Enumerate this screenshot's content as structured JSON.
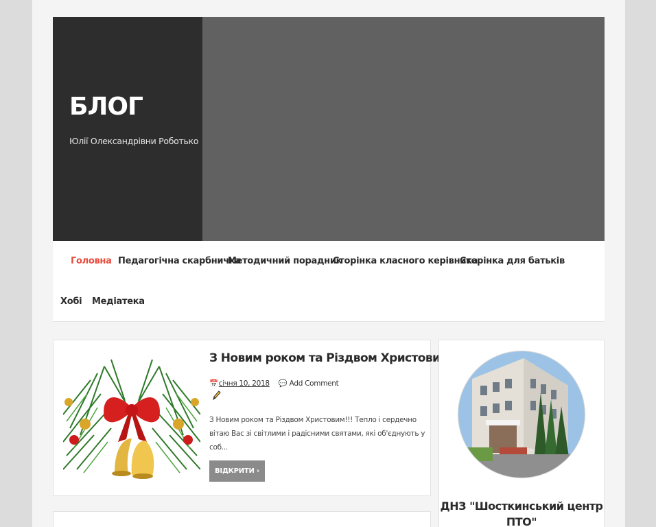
{
  "site": {
    "title": "БЛОГ",
    "description": "Юлії Олександрівни Роботько"
  },
  "nav": {
    "items": [
      {
        "label": "Головна",
        "active": true
      },
      {
        "label": "Педагогічна скарбничка"
      },
      {
        "label": "Методичний порадник"
      },
      {
        "label": "Сторінка класного керівника"
      },
      {
        "label": "Сторінка для батьків"
      },
      {
        "label": "Хобі"
      },
      {
        "label": "Медіатека"
      }
    ]
  },
  "post": {
    "title": "З Новим роком та Різдвом Христовим!!!",
    "date": "січня 10, 2018",
    "comments": "Add Comment",
    "excerpt": "З Новим роком та Різдвом Христовим!!!      Тепло і сердечно вітаю Вас зі світлими і радісними святами, які об'єднують у соб...",
    "more_label": "ВІДКРИТИ"
  },
  "sidebar": {
    "widget_title": "ДНЗ \"Шосткинський центр ПТО\""
  },
  "colors": {
    "accent": "#e84c3d",
    "header_bg": "#616161",
    "branding_bg": "#2d2d2d",
    "button_bg": "#8b8b8b"
  }
}
